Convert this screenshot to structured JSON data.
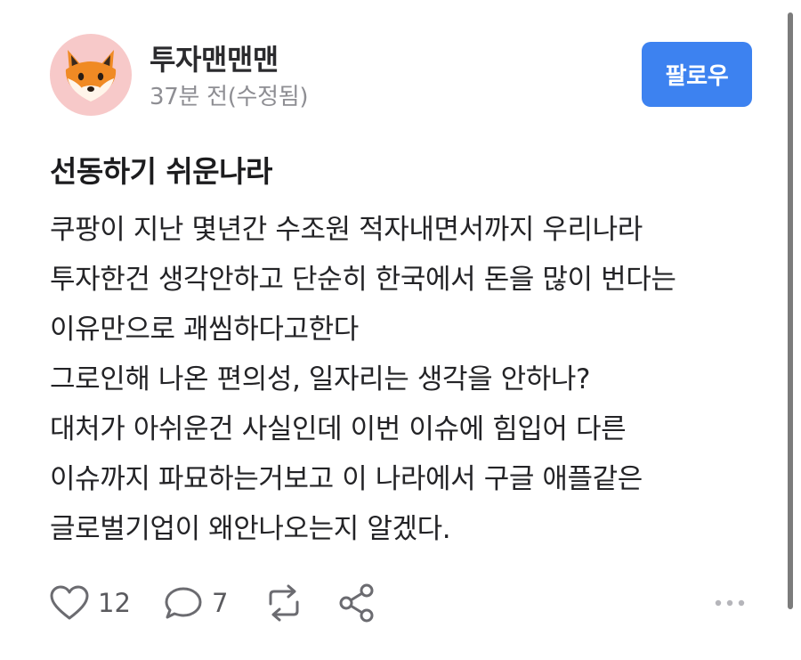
{
  "author": {
    "name": "투자맨맨맨",
    "timestamp": "37분 전(수정됨)",
    "avatar_icon": "fox-icon"
  },
  "follow_button": {
    "label": "팔로우",
    "color": "#3d82f0"
  },
  "post": {
    "title": "선동하기 쉬운나라",
    "lines": [
      "쿠팡이 지난 몇년간 수조원 적자내면서까지 우리나라",
      "투자한건 생각안하고 단순히 한국에서 돈을 많이 번다는",
      "이유만으로 괘씸하다고한다",
      "그로인해 나온 편의성, 일자리는 생각을 안하나?",
      "대처가 아쉬운건 사실인데 이번 이슈에 힘입어 다른",
      "이슈까지 파묘하는거보고 이 나라에서 구글 애플같은",
      "글로벌기업이 왜안나오는지 알겠다."
    ]
  },
  "actions": {
    "like": {
      "icon": "heart-icon",
      "count": "12"
    },
    "comment": {
      "icon": "comment-bubble-icon",
      "count": "7"
    },
    "repost": {
      "icon": "repost-icon"
    },
    "share": {
      "icon": "share-icon"
    },
    "more": {
      "icon": "more-dots-icon"
    }
  }
}
